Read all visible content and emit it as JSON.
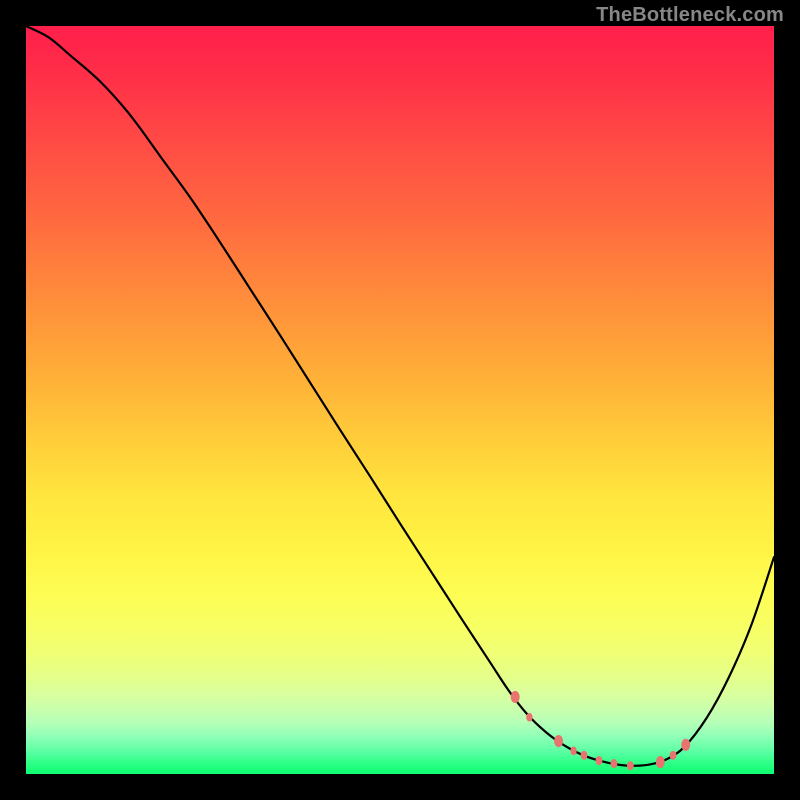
{
  "watermark": "TheBottleneck.com",
  "colors": {
    "curve_stroke": "#000000",
    "marker_fill": "#e7746f",
    "marker_stroke": "#e7746f",
    "background": "#000000"
  },
  "chart_data": {
    "type": "line",
    "title": "",
    "xlabel": "",
    "ylabel": "",
    "xlim": [
      0,
      100
    ],
    "ylim": [
      0,
      100
    ],
    "grid": false,
    "legend": false,
    "series": [
      {
        "name": "bottleneck-curve",
        "x": [
          0,
          3,
          6,
          10,
          14,
          18,
          22,
          26,
          30,
          34,
          38,
          42,
          46,
          50,
          54,
          58,
          62,
          64.5,
          67,
          69.5,
          72,
          74.5,
          77,
          79.5,
          81.5,
          83.5,
          85.5,
          88,
          91,
          94,
          97,
          100
        ],
        "values": [
          100,
          98.5,
          96,
          92.5,
          88,
          82.5,
          77,
          71,
          64.8,
          58.6,
          52.3,
          46,
          39.8,
          33.5,
          27.3,
          21.1,
          15,
          11.2,
          8,
          5.6,
          3.8,
          2.5,
          1.7,
          1.2,
          1.1,
          1.3,
          1.9,
          3.6,
          7.5,
          13,
          20,
          29
        ]
      }
    ],
    "markers": {
      "series": "bottleneck-curve",
      "points": [
        {
          "x": 65.4,
          "y": 10.3,
          "r": 4.5
        },
        {
          "x": 67.3,
          "y": 7.6,
          "r": 3.2
        },
        {
          "x": 71.2,
          "y": 4.4,
          "r": 4.5
        },
        {
          "x": 73.2,
          "y": 3.1,
          "r": 3.2
        },
        {
          "x": 74.6,
          "y": 2.5,
          "r": 3.4
        },
        {
          "x": 76.6,
          "y": 1.8,
          "r": 3.4
        },
        {
          "x": 78.6,
          "y": 1.4,
          "r": 3.4
        },
        {
          "x": 80.8,
          "y": 1.1,
          "r": 3.4
        },
        {
          "x": 84.8,
          "y": 1.6,
          "r": 4.5
        },
        {
          "x": 86.5,
          "y": 2.5,
          "r": 3.4
        },
        {
          "x": 88.2,
          "y": 3.9,
          "r": 4.5
        }
      ]
    }
  }
}
